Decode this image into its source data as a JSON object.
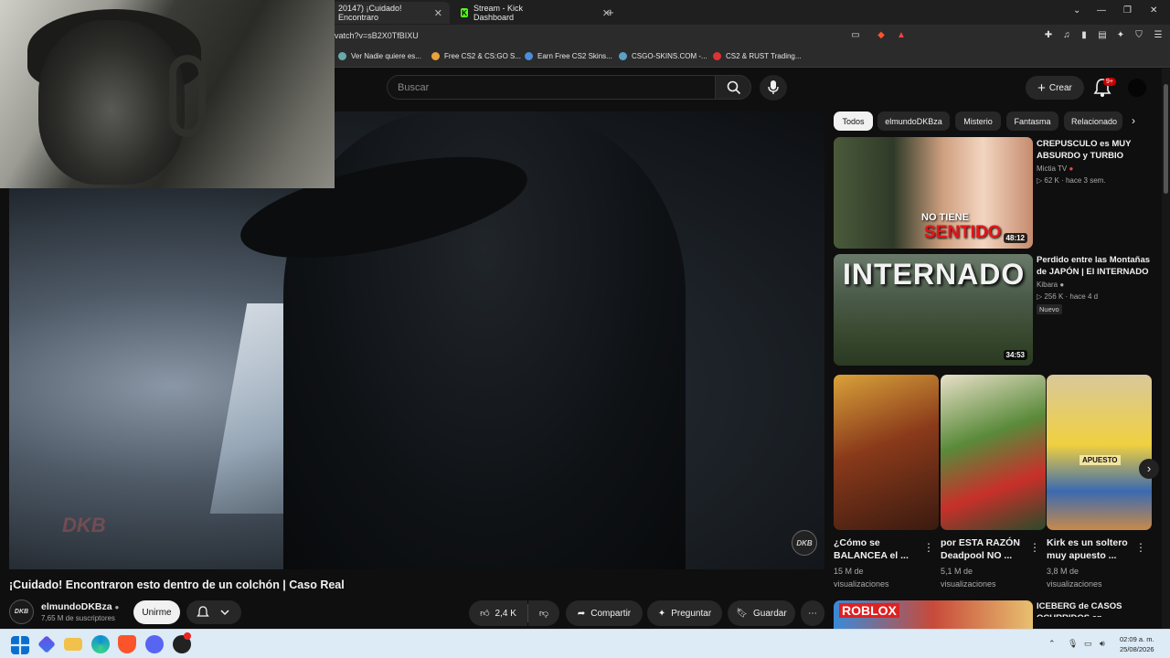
{
  "browser": {
    "tabs": [
      {
        "label": "20147) ¡Cuidado! Encontraro",
        "active": true
      },
      {
        "label": "Stream - Kick Dashboard",
        "active": false
      }
    ],
    "url": "vatch?v=sB2X0TfBIXU",
    "bookmarks": [
      "Ver Nadie quiere es...",
      "Free CS2 & CS:GO S...",
      "Earn Free CS2 Skins...",
      "CSGO-SKINS.COM -...",
      "CS2 & RUST Trading..."
    ]
  },
  "header": {
    "search_placeholder": "Buscar",
    "crear_label": "Crear",
    "notif_badge": "9+"
  },
  "video": {
    "watermark": "DKB",
    "corner_logo": "DKB",
    "title": "¡Cuidado! Encontraron esto dentro de un colchón | Caso Real",
    "channel": {
      "name": "elmundoDKBza",
      "subs": "7,65 M de suscriptores",
      "avatar_text": "DKB"
    },
    "join_label": "Unirme",
    "actions": {
      "likes": "2,4 K",
      "share": "Compartir",
      "ask": "Preguntar",
      "save": "Guardar"
    }
  },
  "sidebar": {
    "chips": [
      "Todos",
      "elmundoDKBza",
      "Misterio",
      "Fantasma",
      "Relacionado"
    ],
    "videos": [
      {
        "title_line1": "CREPUSCULO es MUY",
        "title_line2": "ABSURDO y TURBIO",
        "channel": "Mictia TV",
        "views": "62 K",
        "age": "hace 3 sem.",
        "duration": "48:12",
        "thumb_text1": "NO TIENE",
        "thumb_text2": "SENTIDO"
      },
      {
        "title_line1": "Perdido entre las Montañas",
        "title_line2": "de JAPÓN | El INTERNADO",
        "channel": "Kibara",
        "views": "256 K",
        "age": "hace 4 d",
        "badge": "Nuevo",
        "duration": "34:53",
        "thumb_text1": "INTERNADO"
      }
    ],
    "shorts": [
      {
        "title_line1": "¿Cómo se",
        "title_line2": "BALANCEA el ...",
        "views_line1": "15 M de",
        "views_line2": "visualizaciones"
      },
      {
        "title_line1": "por ESTA RAZÓN",
        "title_line2": "Deadpool NO ...",
        "views_line1": "5,1 M de",
        "views_line2": "visualizaciones"
      },
      {
        "title_line1": "Kirk es un soltero",
        "title_line2": "muy apuesto ...",
        "views_line1": "3,8 M de",
        "views_line2": "visualizaciones",
        "thumb_text": "APUESTO"
      }
    ],
    "next_video": {
      "title_line1": "ICEBERG de CASOS",
      "title_line2": "OCURRIDOS en",
      "thumb_text": "ROBLOX"
    }
  },
  "taskbar": {
    "time": "02:09 a. m.",
    "date": "25/08/2026"
  }
}
